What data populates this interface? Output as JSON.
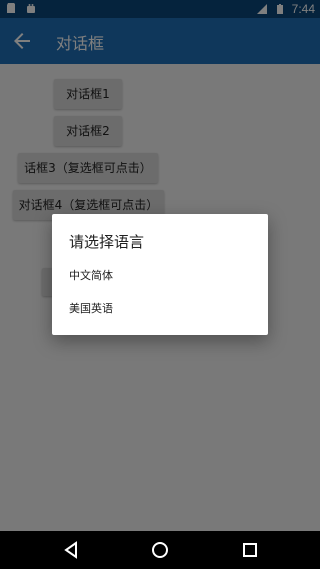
{
  "statusbar": {
    "time": "7:44",
    "left_icons": [
      "sd-card-icon",
      "android-icon"
    ],
    "right_icons": [
      "signal-icon",
      "battery-icon"
    ]
  },
  "appbar": {
    "title": "对话框",
    "back_icon": "arrow-left-icon"
  },
  "buttons": [
    {
      "label": "对话框1"
    },
    {
      "label": "对话框2"
    },
    {
      "label": "话框3（复选框可点击）"
    },
    {
      "label": "对话框4（复选框可点击）"
    }
  ],
  "dialog": {
    "title": "请选择语言",
    "items": [
      "中文简体",
      "美国英语"
    ]
  },
  "navbar": {
    "icons": [
      "back-triangle-icon",
      "home-circle-icon",
      "recents-square-icon"
    ]
  },
  "colors": {
    "statusbar": "#0b467a",
    "appbar": "#1e6fb6",
    "scrim": "rgba(0,0,0,0.5)"
  }
}
